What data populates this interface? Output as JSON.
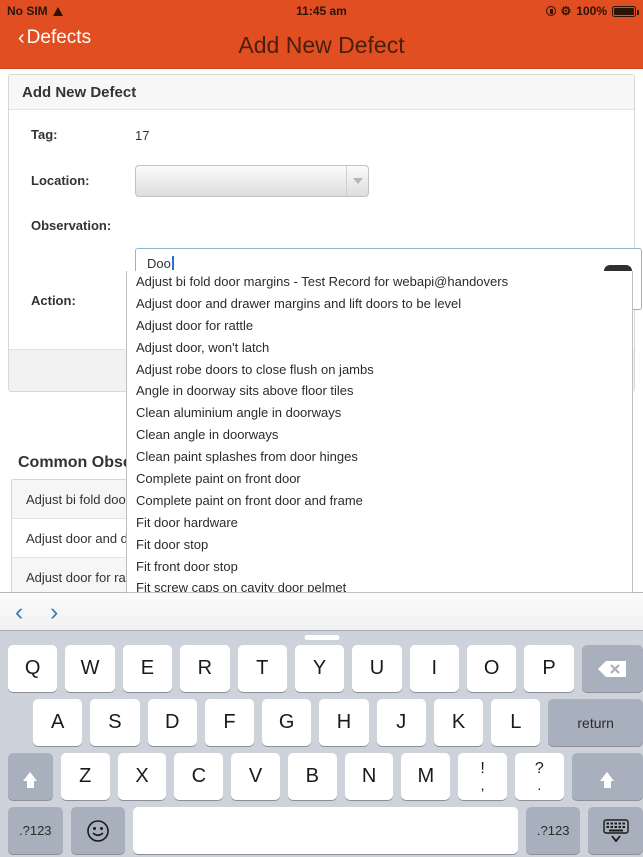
{
  "status_bar": {
    "carrier": "No SIM",
    "wifi_icon": "wifi-icon",
    "time": "11:45 am",
    "rotation_lock_icon": "rotation-lock-icon",
    "bluetooth_icon": "bluetooth-icon",
    "battery_percent": "100%",
    "battery_icon": "battery-icon"
  },
  "nav_bar": {
    "back_label": "Defects",
    "back_chevron": "‹",
    "title": "Add New Defect",
    "background_color": "#e04e22",
    "title_color": "#4a1f0c"
  },
  "card": {
    "header_title": "Add New Defect",
    "fields": {
      "tag_label": "Tag:",
      "tag_value": "17",
      "location_label": "Location:",
      "location_value": "",
      "location_dropdown_icon": "chevron-down-icon",
      "observation_label": "Observation:",
      "observation_value": "Doo",
      "observation_add_icon": "plus-icon",
      "action_label": "Action:"
    }
  },
  "autocomplete": {
    "items": [
      "Adjust bi fold door margins - Test Record for webapi@handovers",
      "Adjust door and drawer margins and lift doors to be level",
      "Adjust door for rattle",
      "Adjust door, won't latch",
      "Adjust robe doors to close flush on jambs",
      "Angle in doorway sits above floor tiles",
      "Clean aluminium angle in doorways",
      "Clean angle in doorways",
      "Clean paint splashes from door hinges",
      "Complete paint on front door",
      "Complete paint on front door and frame",
      "Fit door hardware",
      "Fit door stop",
      "Fit front door stop",
      "Fit screw caps on cavity door pelmet"
    ]
  },
  "common_observations": {
    "title": "Common Observations",
    "rows": [
      {
        "text": "Adjust bi fold door margins - Test Record for webapi@handovers",
        "add_icon": "plus-icon"
      },
      {
        "text": "Adjust door and drawer margins and lift doors to be level",
        "add_icon": "plus-icon"
      },
      {
        "text": "Adjust door for rattle",
        "add_icon": "plus-icon"
      }
    ]
  },
  "keyboard_accessory": {
    "prev_label": "‹",
    "next_label": "›"
  },
  "keyboard": {
    "row1": [
      "Q",
      "W",
      "E",
      "R",
      "T",
      "Y",
      "U",
      "I",
      "O",
      "P"
    ],
    "delete_icon": "backspace-icon",
    "row2": [
      "A",
      "S",
      "D",
      "F",
      "G",
      "H",
      "J",
      "K",
      "L"
    ],
    "return_label": "return",
    "row3": [
      "Z",
      "X",
      "C",
      "V",
      "B",
      "N",
      "M"
    ],
    "punct1_top": "!",
    "punct1_bottom": ",",
    "punct2_top": "?",
    "punct2_bottom": ".",
    "shift_icon": "shift-icon",
    "numeric_label": ".?123",
    "emoji_icon": "emoji-icon",
    "space_label": "",
    "hide_keyboard_icon": "hide-keyboard-icon"
  }
}
